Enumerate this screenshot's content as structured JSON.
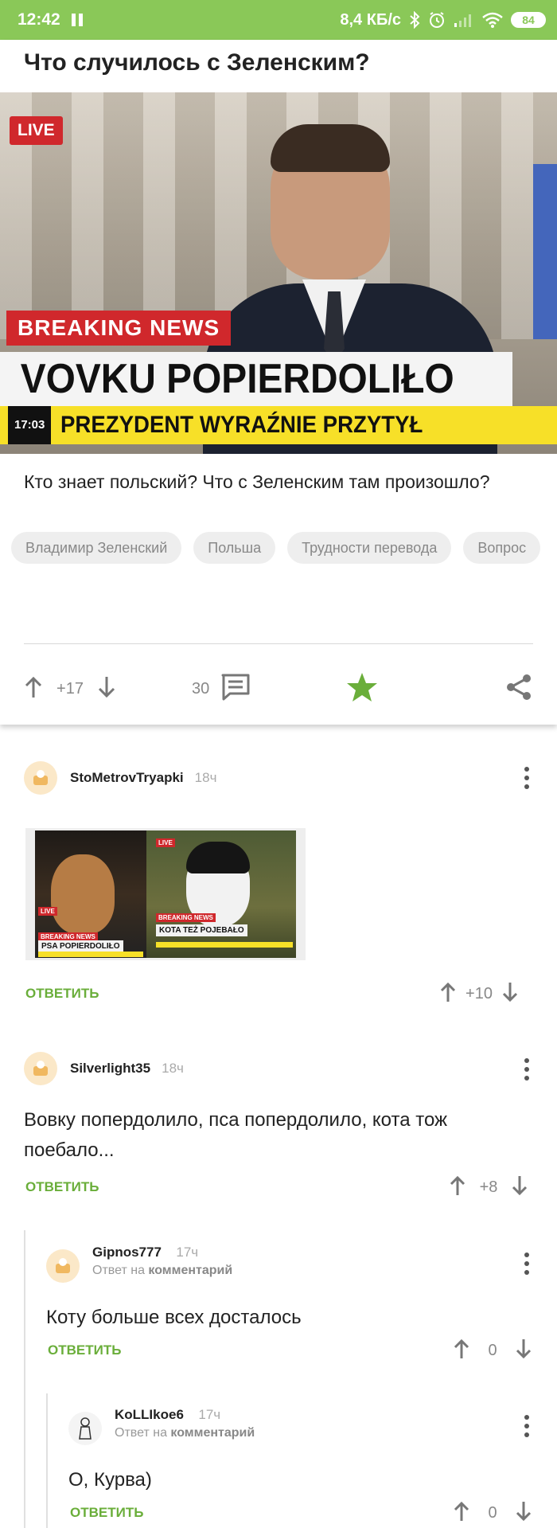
{
  "status_bar": {
    "time": "12:42",
    "net_speed": "8,4 КБ/с",
    "battery": "84",
    "icons": [
      "pause-icon",
      "bluetooth-icon",
      "alarm-icon",
      "signal-icon",
      "wifi-icon",
      "battery-icon"
    ]
  },
  "post": {
    "title": "Что случилось с Зеленским?",
    "image": {
      "live_badge": "LIVE",
      "breaking": "BREAKING NEWS",
      "headline": "VOVKU POPIERDOLIŁO",
      "clock": "17:03",
      "subline": "PREZYDENT WYRAŹNIE PRZYTYŁ"
    },
    "text": "Кто знает польский? Что с Зеленским там произошло?",
    "tags": [
      "Владимир Зеленский",
      "Польша",
      "Трудности перевода",
      "Вопрос"
    ],
    "rating": "+17",
    "comments_count": "30",
    "accent_color": "#6aae3a"
  },
  "comments": [
    {
      "author": "StoMetrovTryapki",
      "time": "18ч",
      "image": {
        "left_live": "LIVE",
        "left_breaking": "BREAKING NEWS",
        "left_caption": "PSA POPIERDOLIŁO",
        "right_live": "LIVE",
        "right_breaking": "BREAKING NEWS",
        "right_caption": "KOTA TEŻ POJEBAŁO"
      },
      "reply": "ОТВЕТИТЬ",
      "rating": "+10"
    },
    {
      "author": "Silverlight35",
      "time": "18ч",
      "text": "Вовку попердолило, пса попердолило, кота тож поебало...",
      "reply": "ОТВЕТИТЬ",
      "rating": "+8"
    },
    {
      "author": "Gipnos777",
      "time": "17ч",
      "reply_to_prefix": "Ответ на",
      "reply_to_target": "комментарий",
      "text": "Коту больше всех досталось",
      "reply": "ОТВЕТИТЬ",
      "rating": "0"
    },
    {
      "author": "KoLLIkoe6",
      "time": "17ч",
      "reply_to_prefix": "Ответ на",
      "reply_to_target": "комментарий",
      "text": "О, Курва)",
      "reply": "ОТВЕТИТЬ",
      "rating": "0"
    }
  ]
}
